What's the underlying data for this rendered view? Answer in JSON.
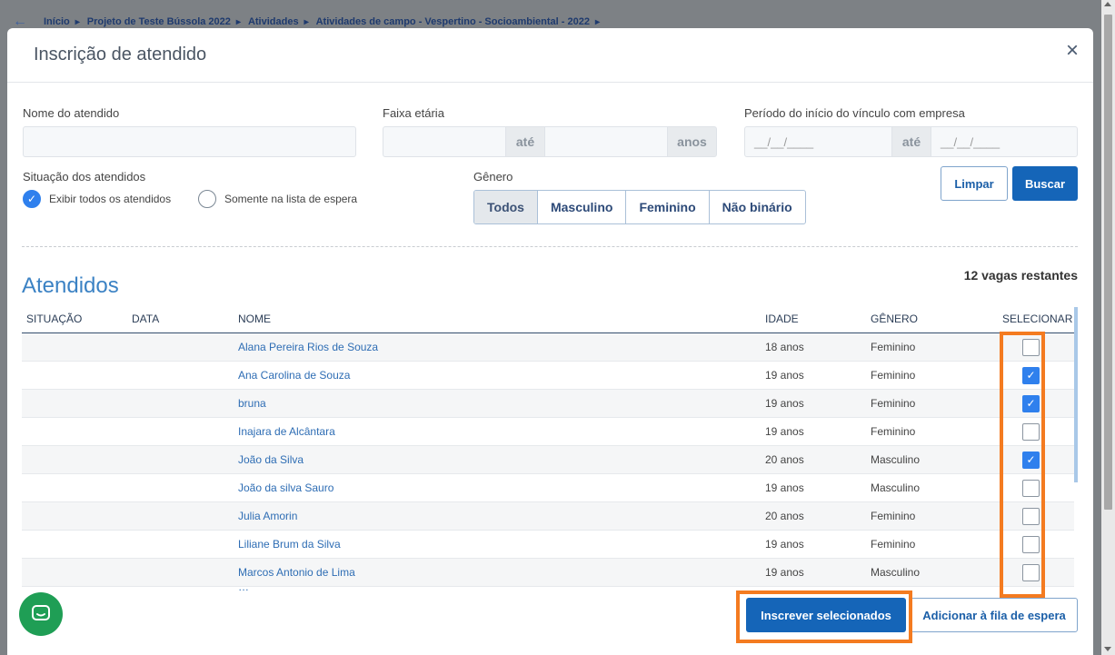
{
  "breadcrumb": {
    "items": [
      "Início",
      "Projeto de Teste Bússola 2022",
      "Atividades",
      "Atividades de campo - Vespertino - Socioambiental - 2022"
    ]
  },
  "modal": {
    "title": "Inscrição de atendido",
    "close_icon": "close-icon"
  },
  "filters": {
    "nome_label": "Nome do atendido",
    "nome_value": "",
    "faixa_label": "Faixa etária",
    "faixa_ate": "até",
    "faixa_anos": "anos",
    "periodo_label": "Período do início do vínculo com empresa",
    "periodo_from_placeholder": "__/__/____",
    "periodo_ate": "até",
    "periodo_to_placeholder": "__/__/____",
    "situacao_label": "Situação dos atendidos",
    "situacao_options": [
      {
        "label": "Exibir todos os atendidos",
        "checked": true
      },
      {
        "label": "Somente na lista de espera",
        "checked": false
      }
    ],
    "genero_label": "Gênero",
    "genero_options": [
      "Todos",
      "Masculino",
      "Feminino",
      "Não binário"
    ],
    "genero_selected": "Todos",
    "limpar_label": "Limpar",
    "buscar_label": "Buscar"
  },
  "list": {
    "title": "Atendidos",
    "vagas": "12 vagas restantes",
    "columns": [
      "SITUAÇÃO",
      "DATA",
      "NOME",
      "IDADE",
      "GÊNERO",
      "SELECIONAR"
    ],
    "rows": [
      {
        "situacao": "",
        "data": "",
        "nome": "Alana Pereira Rios de Souza",
        "idade": "18 anos",
        "genero": "Feminino",
        "selected": false
      },
      {
        "situacao": "",
        "data": "",
        "nome": "Ana Carolina de Souza",
        "idade": "19 anos",
        "genero": "Feminino",
        "selected": true
      },
      {
        "situacao": "",
        "data": "",
        "nome": "bruna",
        "idade": "19 anos",
        "genero": "Feminino",
        "selected": true
      },
      {
        "situacao": "",
        "data": "",
        "nome": "Inajara de Alcântara",
        "idade": "19 anos",
        "genero": "Feminino",
        "selected": false
      },
      {
        "situacao": "",
        "data": "",
        "nome": "João da Silva",
        "idade": "20 anos",
        "genero": "Masculino",
        "selected": true
      },
      {
        "situacao": "",
        "data": "",
        "nome": "João da silva Sauro",
        "idade": "19 anos",
        "genero": "Masculino",
        "selected": false
      },
      {
        "situacao": "",
        "data": "",
        "nome": "Julia Amorin",
        "idade": "20 anos",
        "genero": "Feminino",
        "selected": false
      },
      {
        "situacao": "",
        "data": "",
        "nome": "Liliane Brum da Silva",
        "idade": "19 anos",
        "genero": "Feminino",
        "selected": false
      },
      {
        "situacao": "",
        "data": "",
        "nome": "Marcos Antonio de Lima",
        "idade": "19 anos",
        "genero": "Masculino",
        "selected": false
      }
    ]
  },
  "footer": {
    "inscrever_label": "Inscrever selecionados",
    "fila_label": "Adicionar à fila de espera"
  },
  "colors": {
    "primary": "#1565b8",
    "highlight": "#f47b20",
    "checkbox_on": "#2f80ed",
    "chat": "#1f9e55"
  }
}
